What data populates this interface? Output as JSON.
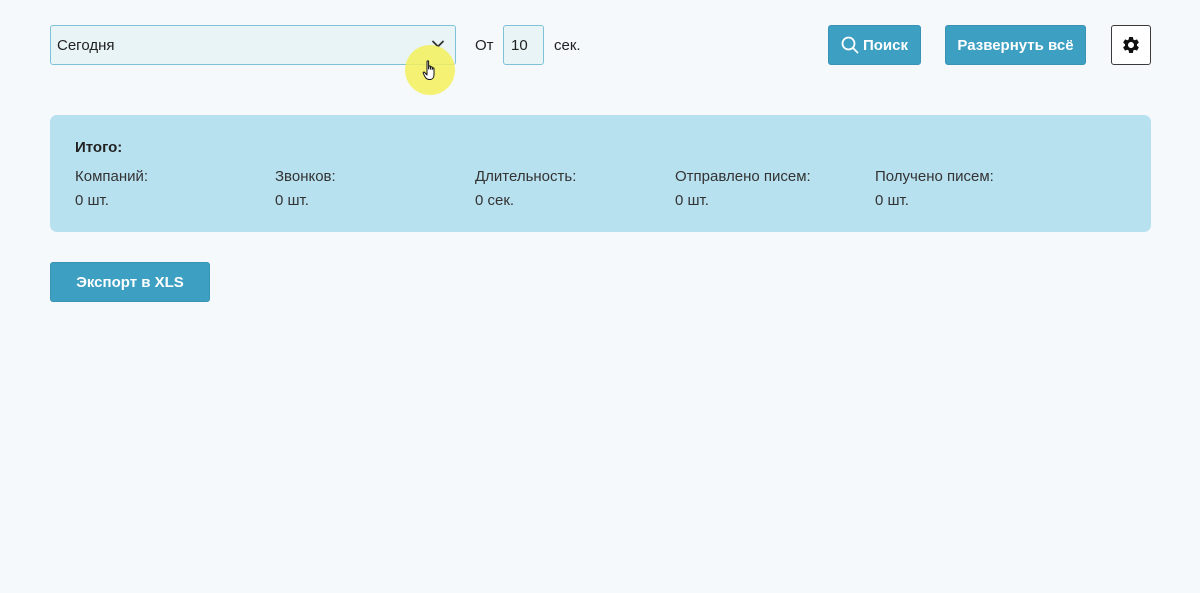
{
  "toolbar": {
    "period_value": "Сегодня",
    "from_label": "От",
    "seconds_value": "10",
    "seconds_unit": "сек.",
    "search_label": "Поиск",
    "expand_all_label": "Развернуть всё",
    "icons": {
      "dropdown": "chevron-down-icon",
      "search": "search-icon",
      "settings": "gear-icon"
    }
  },
  "summary": {
    "title": "Итого:",
    "columns": [
      {
        "label": "Компаний:",
        "value": "0 шт."
      },
      {
        "label": "Звонков:",
        "value": "0 шт."
      },
      {
        "label": "Длительность:",
        "value": "0 сек."
      },
      {
        "label": "Отправлено писем:",
        "value": "0 шт."
      },
      {
        "label": "Получено писем:",
        "value": "0 шт."
      }
    ]
  },
  "export_label": "Экспорт в XLS",
  "colors": {
    "accent": "#3d9fc2",
    "summary_bg": "#b8e1f0",
    "input_bg": "#e8f4f6",
    "input_border": "#7fc1d9",
    "cursor_highlight": "#f5f05a"
  }
}
